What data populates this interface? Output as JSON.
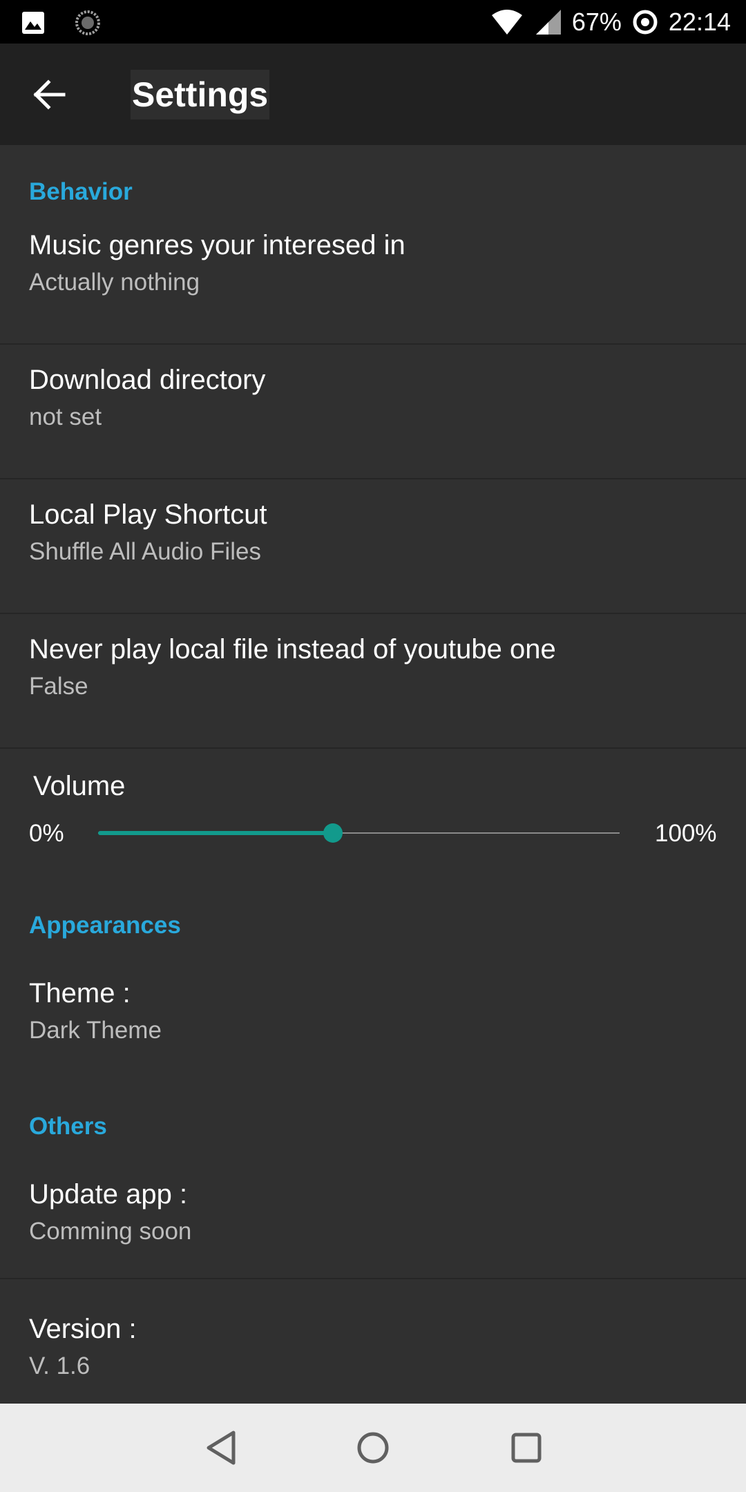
{
  "status_bar": {
    "battery": "67%",
    "time": "22:14"
  },
  "app_bar": {
    "title": "Settings"
  },
  "sections": {
    "behavior": {
      "header": "Behavior",
      "items": [
        {
          "title": "Music genres your interesed in",
          "summary": "Actually nothing"
        },
        {
          "title": "Download directory",
          "summary": "not set"
        },
        {
          "title": "Local Play Shortcut",
          "summary": "Shuffle All Audio Files"
        },
        {
          "title": "Never play local file instead of youtube one",
          "summary": "False"
        }
      ],
      "volume": {
        "title": "Volume",
        "min_label": "0%",
        "max_label": "100%",
        "value": 0.45
      }
    },
    "appearances": {
      "header": "Appearances",
      "items": [
        {
          "title": "Theme :",
          "summary": "Dark Theme"
        }
      ]
    },
    "others": {
      "header": "Others",
      "items": [
        {
          "title": "Update app :",
          "summary": "Comming soon"
        },
        {
          "title": "Version :",
          "summary": "V. 1.6"
        }
      ]
    }
  },
  "colors": {
    "accent": "#29a9dc",
    "slider": "#129a8c",
    "background": "#303030",
    "app_bar": "#212121"
  }
}
